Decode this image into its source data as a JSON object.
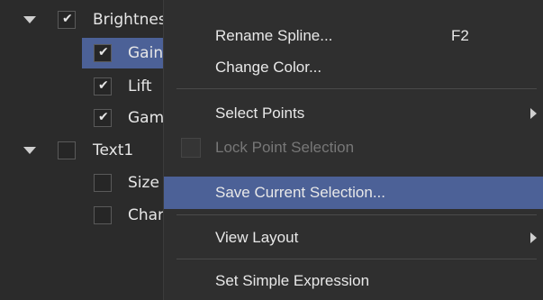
{
  "tree": {
    "items": [
      {
        "label": "Brightness",
        "checked": true,
        "expanded": true
      },
      {
        "label": "Gain",
        "checked": true
      },
      {
        "label": "Lift",
        "checked": true
      },
      {
        "label": "Gamma",
        "checked": true
      },
      {
        "label": "Text1",
        "checked": false,
        "expanded": true
      },
      {
        "label": "Size",
        "checked": false
      },
      {
        "label": "Character",
        "checked": false
      }
    ],
    "selected_index": 1
  },
  "context_menu": {
    "items": [
      {
        "label": "Rename Spline...",
        "shortcut": "F2"
      },
      {
        "label": "Change Color..."
      },
      {
        "label": "Select Points",
        "submenu": true
      },
      {
        "label": "Lock Point Selection",
        "disabled": true,
        "checkbox": true
      },
      {
        "label": "Save Current Selection...",
        "highlighted": true
      },
      {
        "label": "View Layout",
        "submenu": true
      },
      {
        "label": "Set Simple Expression"
      }
    ]
  },
  "colors": {
    "background": "#2b2b2b",
    "menu_background": "#2f2f2f",
    "selection": "#4c6197",
    "text": "#e8e8e8",
    "disabled_text": "#777777"
  }
}
